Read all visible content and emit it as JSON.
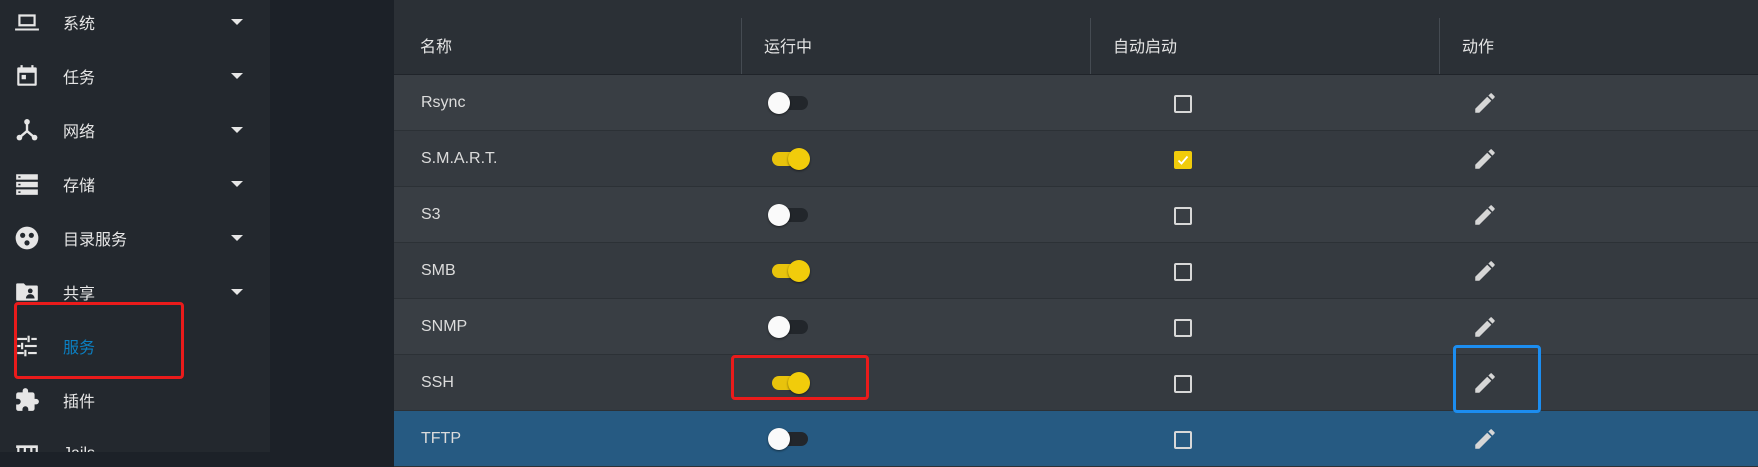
{
  "sidebar": {
    "items": [
      {
        "label": "系统",
        "icon": "laptop-icon",
        "caret": true
      },
      {
        "label": "任务",
        "icon": "calendar-icon",
        "caret": true
      },
      {
        "label": "网络",
        "icon": "network-icon",
        "caret": true
      },
      {
        "label": "存储",
        "icon": "storage-icon",
        "caret": true
      },
      {
        "label": "目录服务",
        "icon": "directory-services-icon",
        "caret": true
      },
      {
        "label": "共享",
        "icon": "shared-folder-icon",
        "caret": true
      },
      {
        "label": "服务",
        "icon": "tune-sliders-icon",
        "caret": false,
        "active": true
      },
      {
        "label": "插件",
        "icon": "puzzle-plugin-icon",
        "caret": false
      },
      {
        "label": "Jails",
        "icon": "jail-icon",
        "caret": false
      }
    ]
  },
  "table": {
    "headers": [
      "名称",
      "运行中",
      "自动启动",
      "动作"
    ],
    "rows": [
      {
        "name": "Rsync",
        "running": false,
        "autostart": false
      },
      {
        "name": "S.M.A.R.T.",
        "running": true,
        "autostart": true
      },
      {
        "name": "S3",
        "running": false,
        "autostart": false
      },
      {
        "name": "SMB",
        "running": true,
        "autostart": false
      },
      {
        "name": "SNMP",
        "running": false,
        "autostart": false
      },
      {
        "name": "SSH",
        "running": true,
        "autostart": false
      },
      {
        "name": "TFTP",
        "running": false,
        "autostart": false,
        "selected": true
      }
    ]
  },
  "colors": {
    "accent_yellow": "#f1cc0b",
    "active_blue": "#0b7fc2",
    "selected_row": "#265a82",
    "annotation_red": "#ea1b1b",
    "annotation_blue": "#1c8df0"
  }
}
